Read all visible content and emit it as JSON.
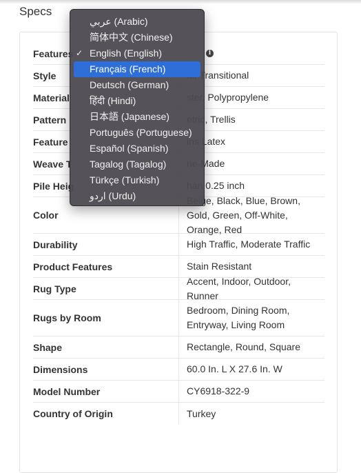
{
  "specs_title": "Specs",
  "specs": [
    {
      "label": "Features",
      "value": "",
      "info": true
    },
    {
      "label": "Style",
      "value": "al, Transitional"
    },
    {
      "label": "Material",
      "value": "ster, Polypropylene"
    },
    {
      "label": "Pattern",
      "value": "etric, Trellis"
    },
    {
      "label": "Feature",
      "value": "ins Latex"
    },
    {
      "label": "Weave T",
      "value": "ne-Made"
    },
    {
      "label": "Pile Heig",
      "value": "han 0.25 inch"
    },
    {
      "label": "Color",
      "value": "Beige, Black, Blue, Brown, Gold, Green, Off-White, Orange, Red"
    },
    {
      "label": "Durability",
      "value": "High Traffic, Moderate Traffic"
    },
    {
      "label": "Product Features",
      "value": "Stain Resistant"
    },
    {
      "label": "Rug Type",
      "value": "Accent, Indoor, Outdoor, Runner"
    },
    {
      "label": "Rugs by Room",
      "value": "Bedroom, Dining Room, Entryway, Living Room"
    },
    {
      "label": "Shape",
      "value": "Rectangle, Round, Square"
    },
    {
      "label": "Dimensions",
      "value": "60.0 In. L X 27.6 In. W"
    },
    {
      "label": "Model Number",
      "value": "CY6918-322-9"
    },
    {
      "label": "Country of Origin",
      "value": "Turkey"
    }
  ],
  "info_icon": "info-circle-icon",
  "language_menu": {
    "check_glyph": "✓",
    "checked_index": 2,
    "highlighted_index": 3,
    "highlight_color": "#2d6ed8",
    "items": [
      "عربي (Arabic)",
      "简体中文 (Chinese)",
      "English (English)",
      "Français (French)",
      "Deutsch (German)",
      "हिंदी (Hindi)",
      "日本語 (Japanese)",
      "Português (Portuguese)",
      "Español (Spanish)",
      "Tagalog (Tagalog)",
      "Türkçe (Turkish)",
      "اردو (Urdu)"
    ]
  }
}
